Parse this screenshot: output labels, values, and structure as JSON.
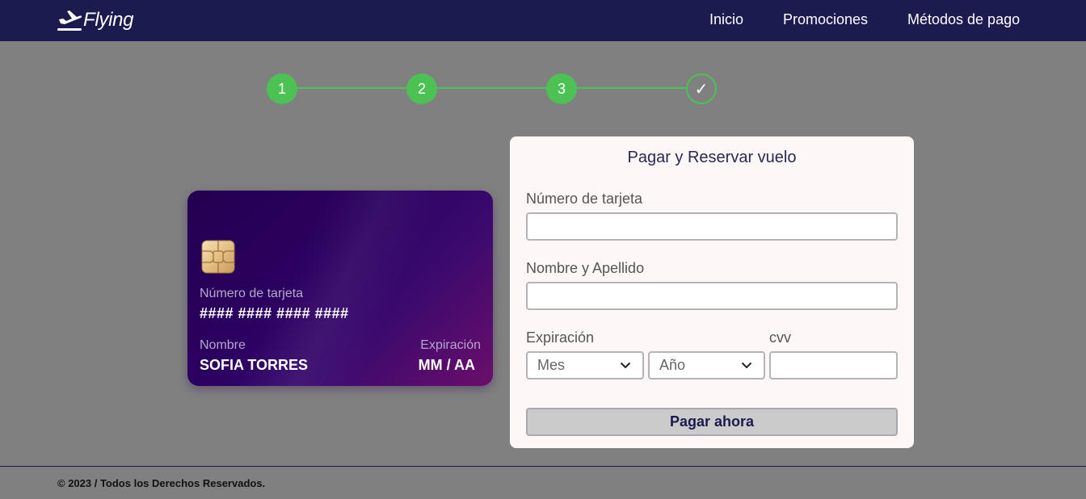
{
  "brand": {
    "name": "Flying",
    "icon": "airplane-icon"
  },
  "nav": [
    {
      "label": "Inicio"
    },
    {
      "label": "Promociones"
    },
    {
      "label": "Métodos de pago"
    }
  ],
  "stepper": {
    "steps": [
      "1",
      "2",
      "3",
      "✓"
    ],
    "color": "#4cc254"
  },
  "card": {
    "number_label": "Número de tarjeta",
    "number_value": "#### #### #### ####",
    "name_label": "Nombre",
    "name_value": "SOFIA TORRES",
    "exp_label": "Expiración",
    "exp_value": "MM / AA"
  },
  "form": {
    "title": "Pagar y Reservar vuelo",
    "card_number_label": "Número de tarjeta",
    "card_number_value": "",
    "name_label": "Nombre y Apellido",
    "name_value": "",
    "expiry_label": "Expiración",
    "month_selected": "Mes",
    "year_selected": "Año",
    "cvv_label": "cvv",
    "cvv_value": "",
    "submit_label": "Pagar ahora"
  },
  "footer": {
    "text": "© 2023 / Todos los Derechos Reservados."
  },
  "colors": {
    "navbar": "#1b1b50",
    "background": "#808080",
    "accent": "#4cc254"
  }
}
